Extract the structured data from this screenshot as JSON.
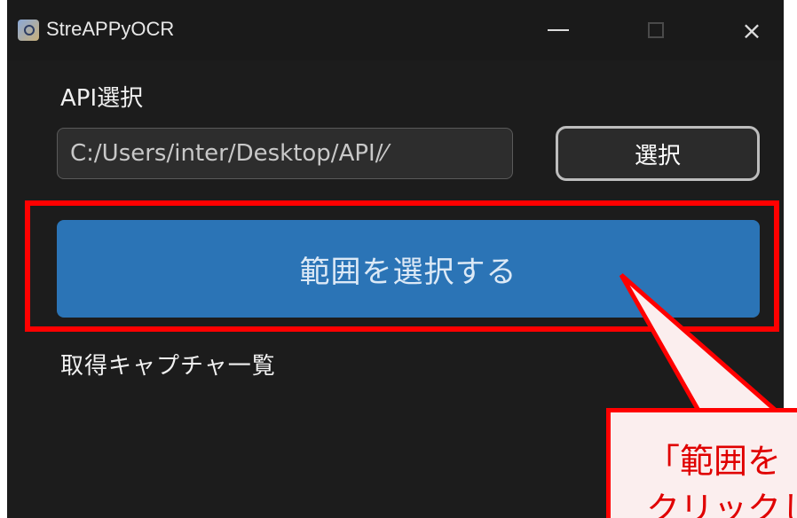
{
  "window": {
    "title": "StreAPPyOCR",
    "icon": "app-icon",
    "controls": {
      "minimize": "minimize-icon",
      "maximize": "maximize-icon",
      "close": "×"
    }
  },
  "api": {
    "label": "API選択",
    "path_value": "C:/Users/inter/Desktop/API/⁄",
    "select_button_label": "選択"
  },
  "main": {
    "range_button_label": "範囲を選択する",
    "capture_list_label": "取得キャプチャ一覧"
  },
  "annotation": {
    "line1": "「範囲を",
    "line2": "クリックし",
    "color": "#ff0000"
  },
  "colors": {
    "window_bg": "#1c1c1c",
    "accent_button": "#2b74b6",
    "highlight": "#ff0000"
  }
}
